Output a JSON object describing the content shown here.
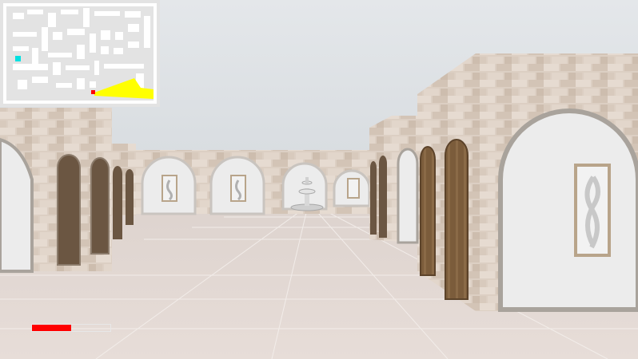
{
  "hud": {
    "health_fraction": 0.5,
    "health_color": "#ff0000",
    "minimap": {
      "background": "#e3e3e3",
      "wall_color": "#ffffff",
      "player_color": "#ff0000",
      "view_cone_color": "#ffff00",
      "marker_color": "#00e0e0"
    }
  },
  "scene": {
    "sky_color": "#dfe3e6",
    "floor_color": "#e4dad6",
    "wall_color": "#e8e8e8",
    "stone_color": "#ddd0c4",
    "door_color": "#7a5c3c"
  }
}
